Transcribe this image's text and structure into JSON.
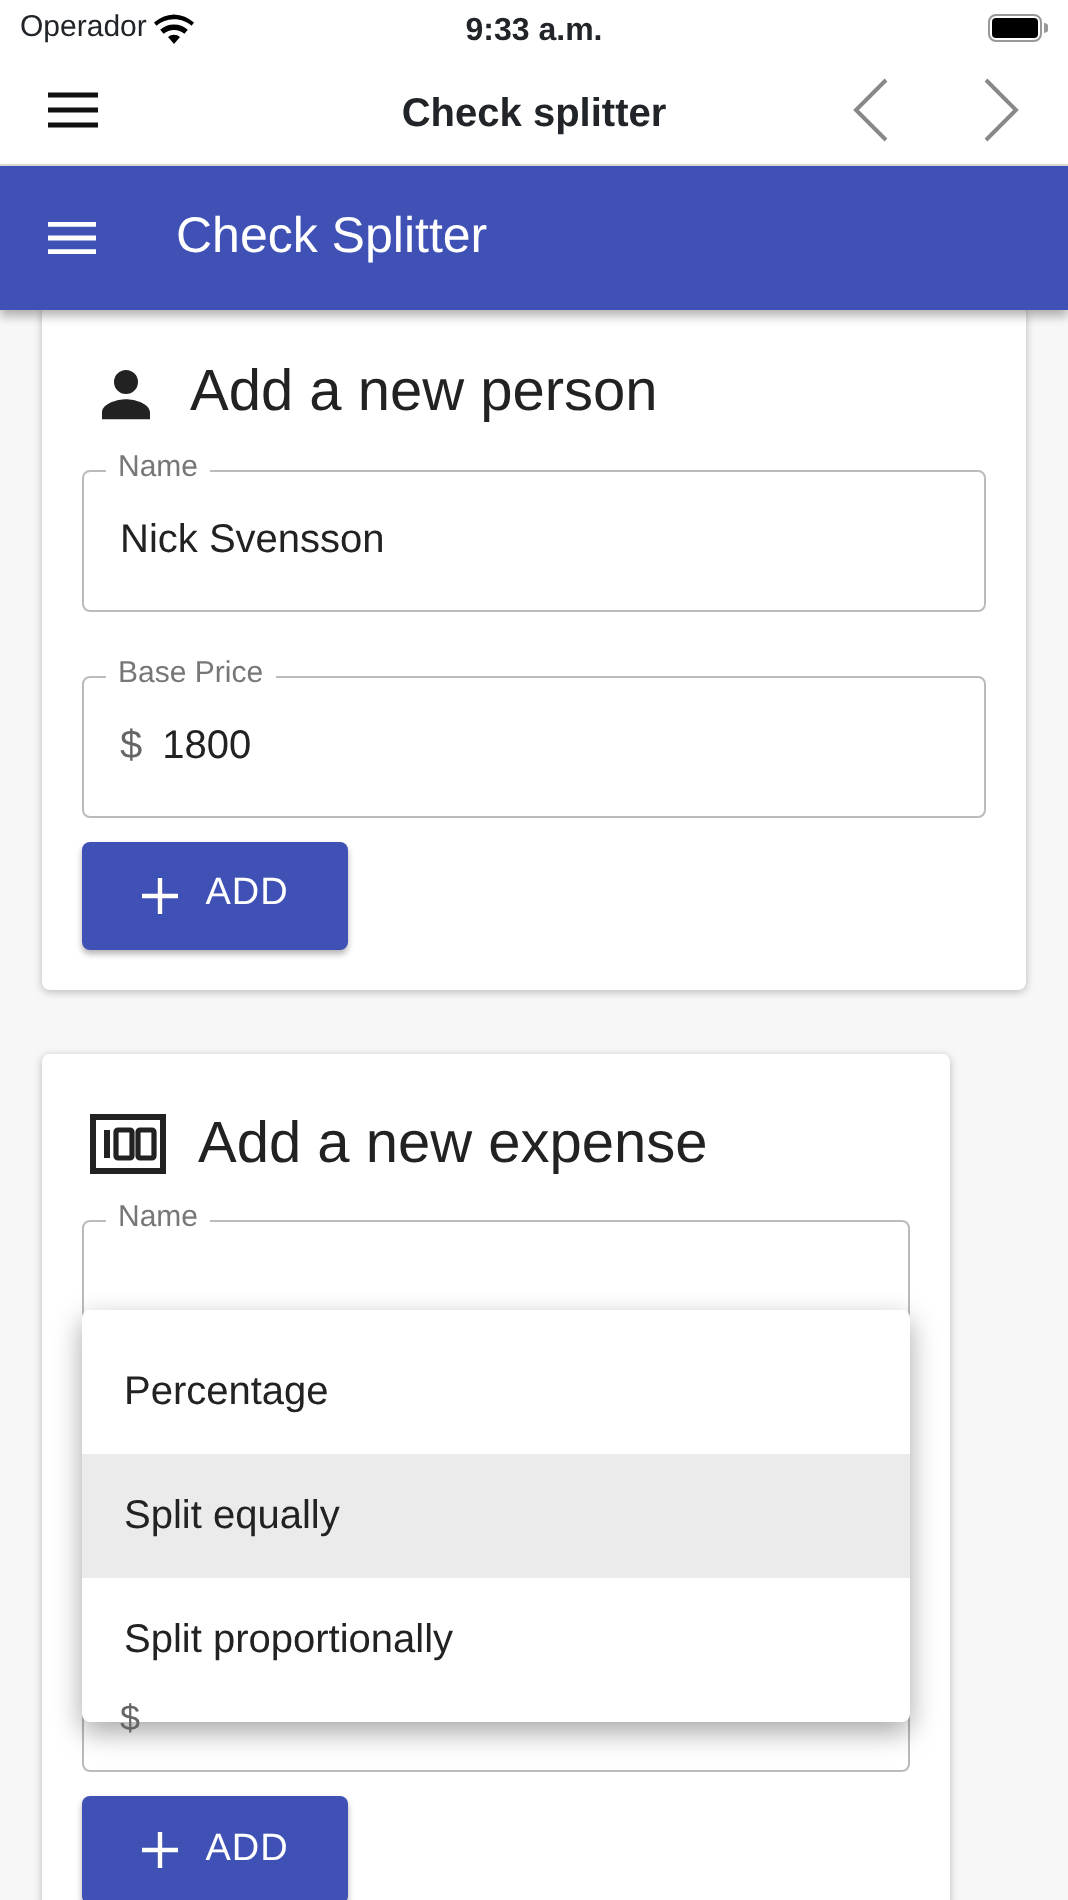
{
  "status_bar": {
    "carrier": "Operador",
    "time": "9:33 a.m."
  },
  "nav_bar": {
    "title": "Check splitter"
  },
  "app_bar": {
    "title": "Check Splitter"
  },
  "person_card": {
    "title": "Add a new person",
    "fields": [
      {
        "label": "Name",
        "value": "Nick Svensson"
      },
      {
        "label": "Base Price",
        "prefix": "$",
        "value": "1800"
      }
    ],
    "button": "ADD"
  },
  "expense_card": {
    "title": "Add a new expense",
    "name_field": {
      "label": "Name"
    },
    "amount_field": {
      "prefix": "$"
    },
    "button": "ADD"
  },
  "dropdown": {
    "options": [
      {
        "label": "Percentage",
        "selected": false
      },
      {
        "label": "Split equally",
        "selected": true
      },
      {
        "label": "Split proportionally",
        "selected": false
      }
    ]
  }
}
